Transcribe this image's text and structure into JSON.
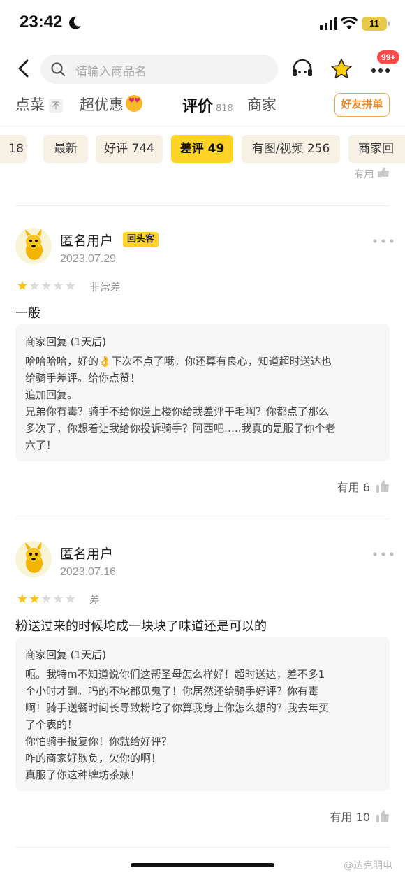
{
  "status": {
    "time": "23:42",
    "battery": "11"
  },
  "search": {
    "placeholder": "请输入商品名"
  },
  "header": {
    "cart_badge": "99+"
  },
  "tabs": [
    {
      "label": "点菜",
      "mini": "不"
    },
    {
      "label": "超优惠"
    },
    {
      "label": "评价",
      "count": "818"
    },
    {
      "label": "商家"
    }
  ],
  "group_button": "好友拼单",
  "filters": [
    "18",
    "最新",
    "好评 744",
    "差评 49",
    "有图/视频 256",
    "商家回"
  ],
  "prev_useful": "有用",
  "reviews": [
    {
      "user": "匿名用户",
      "tag": "回头客",
      "date": "2023.07.29",
      "stars": 1,
      "rating_text": "非常差",
      "content": "一般",
      "reply_head": "商家回复 (1天后)",
      "reply_lines": [
        "哈哈哈哈，好的👌下次不点了哦。你还算有良心，知道超时送达也",
        "给骑手差评。给你点赞！",
        "追加回复。",
        "兄弟你有毒？骑手不给你送上楼你给我差评干毛啊？你都点了那么",
        "多次了，你想着让我给你投诉骑手？阿西吧…..我真的是服了你个老",
        "六了！"
      ],
      "useful": "有用 6"
    },
    {
      "user": "匿名用户",
      "date": "2023.07.16",
      "stars": 2,
      "rating_text": "差",
      "content": "粉送过来的时候坨成一块块了味道还是可以的",
      "reply_head": "商家回复 (1天后)",
      "reply_lines": [
        "呃。我特m不知道说你们这帮圣母怎么样好！超时送达，差不多1",
        "个小时才到。吗的不坨都见鬼了！你居然还给骑手好评？你有毒",
        "啊！骑手送餐时间长导致粉坨了你算我身上你怎么想的？我去年买",
        "了个表的！",
        "你怕骑手报复你！你就给好评？",
        "咋的商家好欺负，欠你的啊！",
        "真服了你这种牌坊茶婊！"
      ],
      "useful": "有用 10"
    }
  ],
  "watermark": "@达克明电"
}
